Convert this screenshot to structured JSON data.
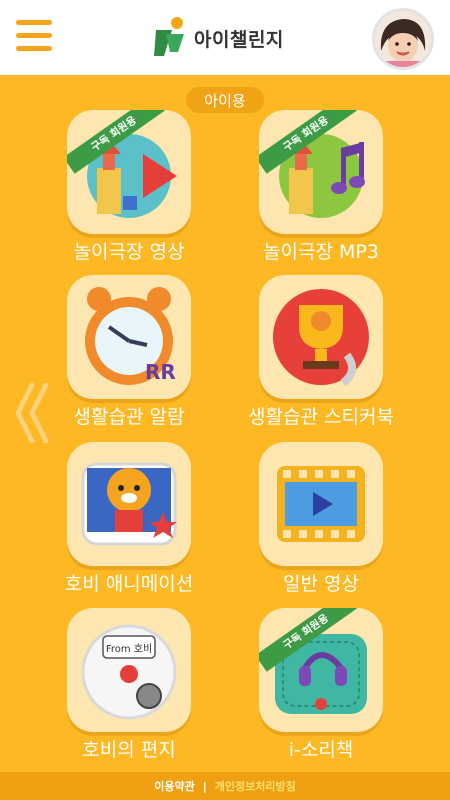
{
  "header": {
    "app_title": "아이챌린지",
    "menu_icon": "hamburger-icon",
    "avatar": "profile-photo"
  },
  "section": {
    "label": "아이용"
  },
  "tiles": [
    {
      "label": "놀이극장 영상",
      "badge": "구독 회원용",
      "icon": "video-play-icon"
    },
    {
      "label": "놀이극장 MP3",
      "badge": "구독 회원용",
      "icon": "music-note-icon"
    },
    {
      "label": "생활습관 알람",
      "badge": "",
      "icon": "alarm-clock-icon"
    },
    {
      "label": "생활습관 스티커북",
      "badge": "",
      "icon": "trophy-icon"
    },
    {
      "label": "호비 애니메이션",
      "badge": "",
      "icon": "tiger-character-icon"
    },
    {
      "label": "일반 영상",
      "badge": "",
      "icon": "film-play-icon"
    },
    {
      "label": "호비의 편지",
      "badge": "",
      "icon": "letter-icon",
      "letter_text": "From 호비"
    },
    {
      "label": "i-소리책",
      "badge": "구독 회원용",
      "icon": "headphones-book-icon"
    }
  ],
  "footer": {
    "terms": "이용약관",
    "separator": "|",
    "privacy": "개인정보처리방침"
  },
  "colors": {
    "background": "#fdb823",
    "accent": "#f0a415",
    "badge": "#3d9a45"
  }
}
